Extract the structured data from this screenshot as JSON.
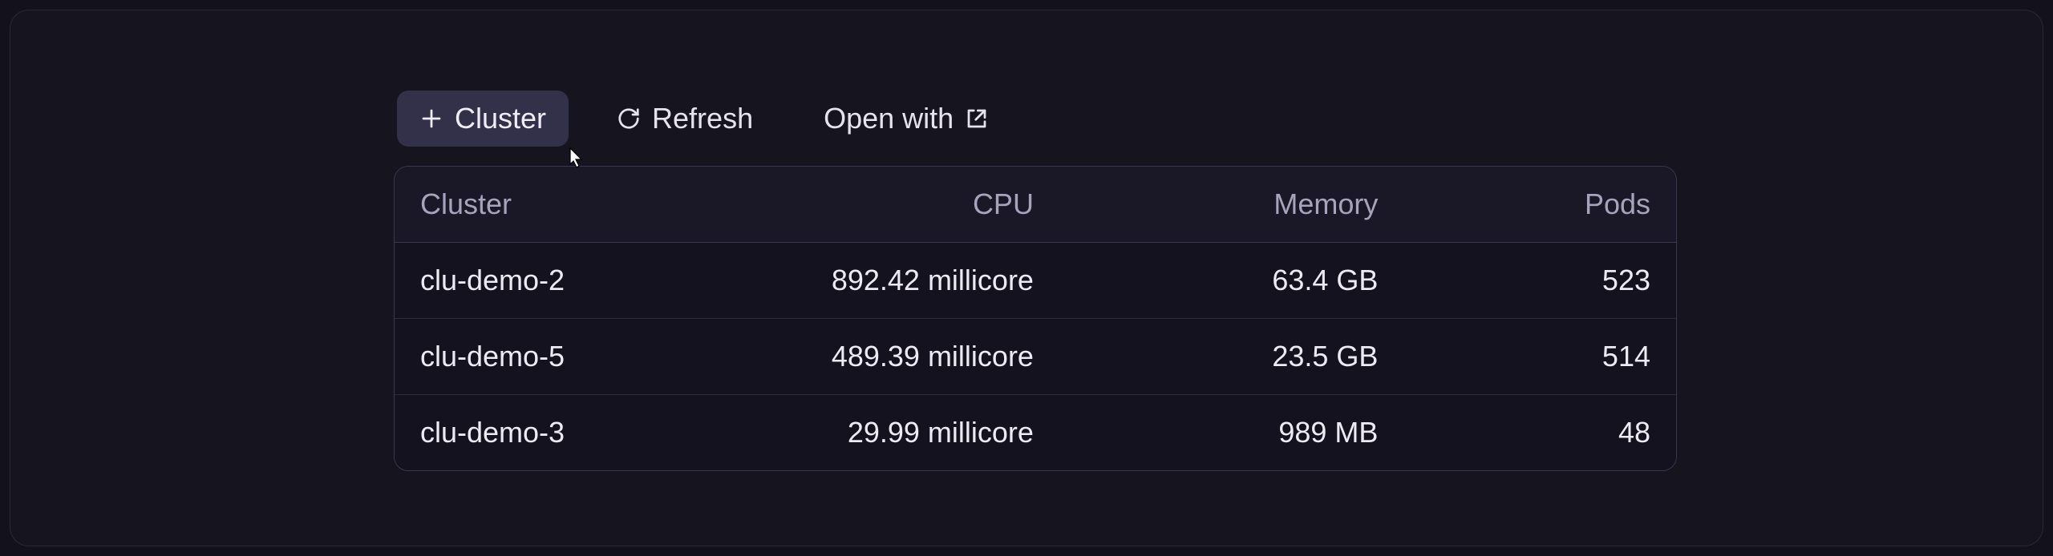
{
  "toolbar": {
    "add_cluster_label": "Cluster",
    "refresh_label": "Refresh",
    "open_with_label": "Open with"
  },
  "table": {
    "headers": {
      "cluster": "Cluster",
      "cpu": "CPU",
      "memory": "Memory",
      "pods": "Pods"
    },
    "rows": [
      {
        "cluster": "clu-demo-2",
        "cpu": "892.42 millicore",
        "memory": "63.4 GB",
        "pods": "523"
      },
      {
        "cluster": "clu-demo-5",
        "cpu": "489.39 millicore",
        "memory": "23.5 GB",
        "pods": "514"
      },
      {
        "cluster": "clu-demo-3",
        "cpu": "29.99 millicore",
        "memory": "989 MB",
        "pods": "48"
      }
    ]
  }
}
